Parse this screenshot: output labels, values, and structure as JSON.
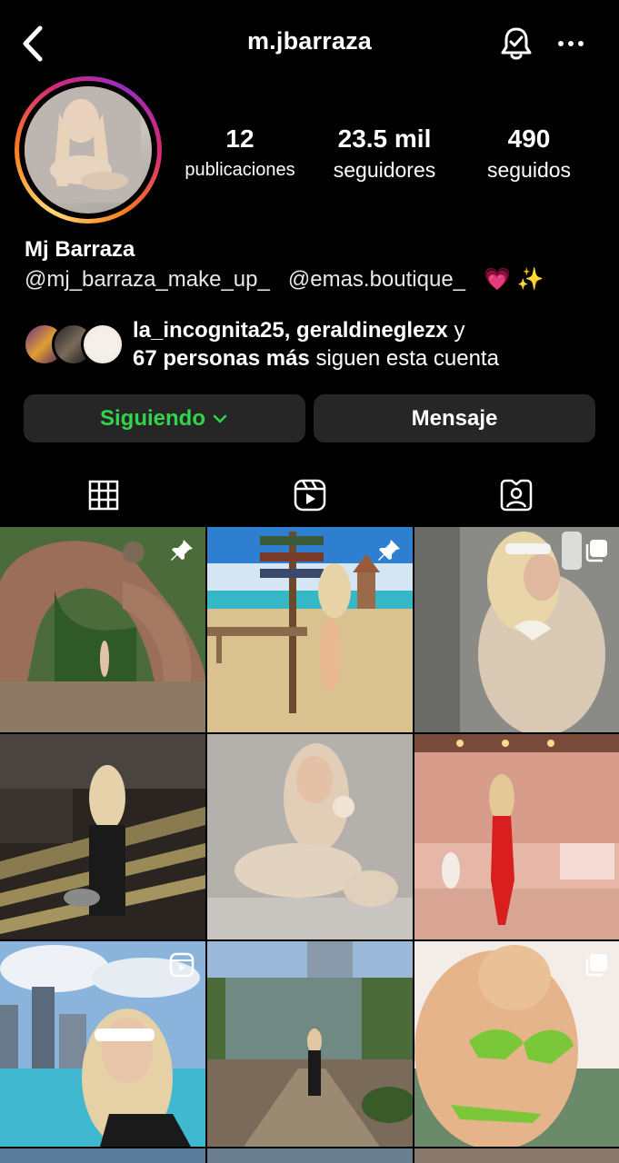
{
  "header": {
    "username": "m.jbarraza",
    "icons": {
      "back": "chevron-left-icon",
      "notifications": "bell-check-icon",
      "more": "more-horizontal-icon"
    }
  },
  "profile": {
    "avatar_icon": "profile-photo",
    "stats": [
      {
        "value": "12",
        "label": "publicaciones"
      },
      {
        "value": "23.5 mil",
        "label": "seguidores"
      },
      {
        "value": "490",
        "label": "seguidos"
      }
    ],
    "full_name": "Mj Barraza",
    "bio": {
      "mention_1": "@mj_barraza_make_up_",
      "mention_2": "@emas.boutique_",
      "emoji": "💗 ✨"
    },
    "followed_by": {
      "names": "la_incognita25, geraldineglezx",
      "connector": " y",
      "count_text": "67 personas más",
      "suffix": " siguen esta cuenta"
    }
  },
  "actions": {
    "follow_label": "Siguiendo",
    "message_label": "Mensaje"
  },
  "tabs": [
    {
      "icon": "grid-icon",
      "active": true
    },
    {
      "icon": "reels-icon",
      "active": false
    },
    {
      "icon": "tagged-icon",
      "active": false
    }
  ],
  "colors": {
    "following_green": "#33d44b",
    "button_bg": "#262626",
    "background": "#000000"
  },
  "posts": [
    {
      "overlay": "pin-icon"
    },
    {
      "overlay": "pin-icon"
    },
    {
      "overlay": "carousel-icon"
    },
    {
      "overlay": ""
    },
    {
      "overlay": ""
    },
    {
      "overlay": ""
    },
    {
      "overlay": "reel-icon"
    },
    {
      "overlay": ""
    },
    {
      "overlay": "carousel-icon"
    }
  ]
}
